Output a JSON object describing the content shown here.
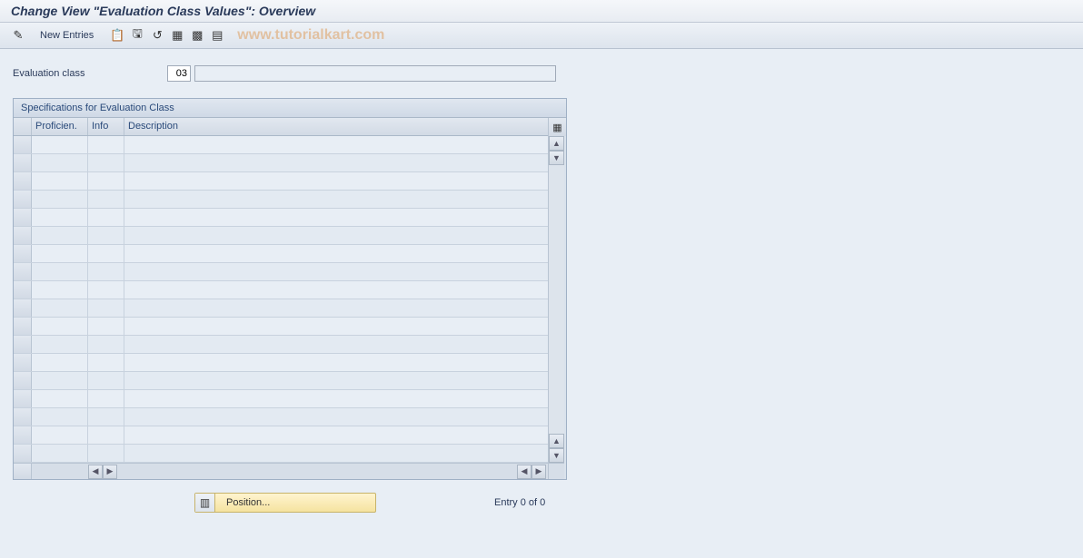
{
  "title": "Change View \"Evaluation Class Values\": Overview",
  "toolbar": {
    "new_entries": "New Entries"
  },
  "watermark": "www.tutorialkart.com",
  "field": {
    "label": "Evaluation class",
    "value": "03",
    "desc": ""
  },
  "panel": {
    "title": "Specifications for Evaluation Class",
    "columns": {
      "proficiency": "Proficien.",
      "info": "Info",
      "description": "Description"
    },
    "row_count": 18
  },
  "footer": {
    "position_label": "Position...",
    "entry_text": "Entry 0 of 0"
  },
  "icons": {
    "toggle": "✎",
    "copy": "📋",
    "save_var": "🖫",
    "undo": "↺",
    "select_all": "▦",
    "select_block": "▩",
    "deselect": "▤",
    "configure": "▦",
    "up": "▲",
    "down": "▼",
    "left": "◀",
    "right": "▶",
    "position": "▥"
  }
}
